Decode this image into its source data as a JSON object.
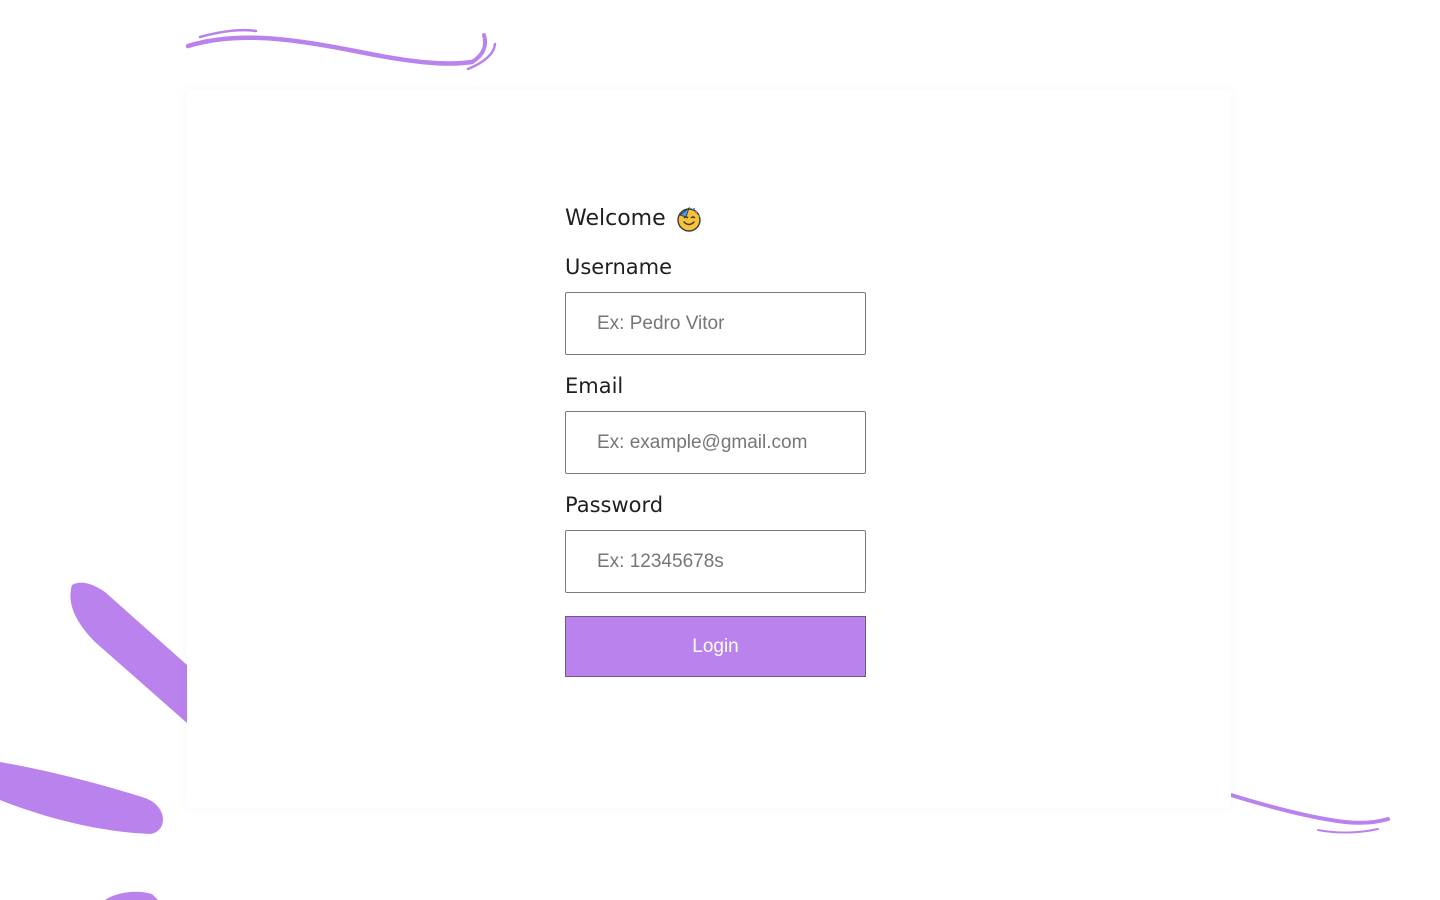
{
  "colors": {
    "accent": "#b982ec",
    "background": "#ffffff",
    "text": "#1f1f1f",
    "input_border": "#7a7a7a",
    "placeholder": "#767676"
  },
  "login_form": {
    "title": "Welcome",
    "title_emoji_icon": "partying-face-emoji-icon",
    "fields": [
      {
        "label": "Username",
        "placeholder": "Ex: Pedro Vitor",
        "value": ""
      },
      {
        "label": "Email",
        "placeholder": "Ex: example@gmail.com",
        "value": ""
      },
      {
        "label": "Password",
        "placeholder": "Ex: 12345678s",
        "value": ""
      }
    ],
    "submit_label": "Login"
  }
}
